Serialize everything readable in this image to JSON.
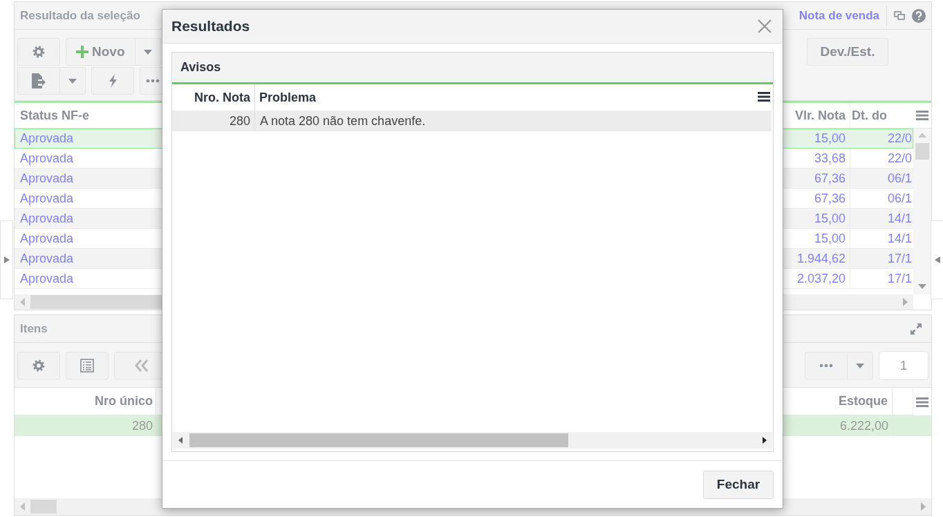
{
  "top_panel": {
    "title": "Resultado da seleção",
    "link": "Nota de venda"
  },
  "top_toolbar": {
    "new_button": "Novo",
    "dev_button": "Dev./Est."
  },
  "top_grid": {
    "columns": [
      "Status NF-e",
      "Vlr. Nota",
      "Dt. do"
    ],
    "rows": [
      {
        "status": "Aprovada",
        "value": "15,00",
        "date": "22/0",
        "selected": true
      },
      {
        "status": "Aprovada",
        "value": "33,68",
        "date": "22/0",
        "selected": false
      },
      {
        "status": "Aprovada",
        "value": "67,36",
        "date": "06/1",
        "selected": false
      },
      {
        "status": "Aprovada",
        "value": "67,36",
        "date": "06/1",
        "selected": false
      },
      {
        "status": "Aprovada",
        "value": "15,00",
        "date": "14/1",
        "selected": false
      },
      {
        "status": "Aprovada",
        "value": "15,00",
        "date": "14/1",
        "selected": false
      },
      {
        "status": "Aprovada",
        "value": "1.944,62",
        "date": "17/1",
        "selected": false
      },
      {
        "status": "Aprovada",
        "value": "2.037,20",
        "date": "17/1",
        "selected": false
      }
    ]
  },
  "items_panel": {
    "title": "Itens",
    "page": "1"
  },
  "items_grid": {
    "columns": [
      "Nro único",
      "Estoque"
    ],
    "rows": [
      {
        "number": "280",
        "stock": "6.222,00",
        "selected": true
      }
    ]
  },
  "dialog": {
    "title": "Resultados",
    "section": "Avisos",
    "columns": [
      "Nro. Nota",
      "Problema"
    ],
    "rows": [
      {
        "number": "280",
        "problem": "A nota 280 não tem chavenfe.",
        "selected": true
      }
    ],
    "buttons": [
      "Fechar"
    ]
  }
}
